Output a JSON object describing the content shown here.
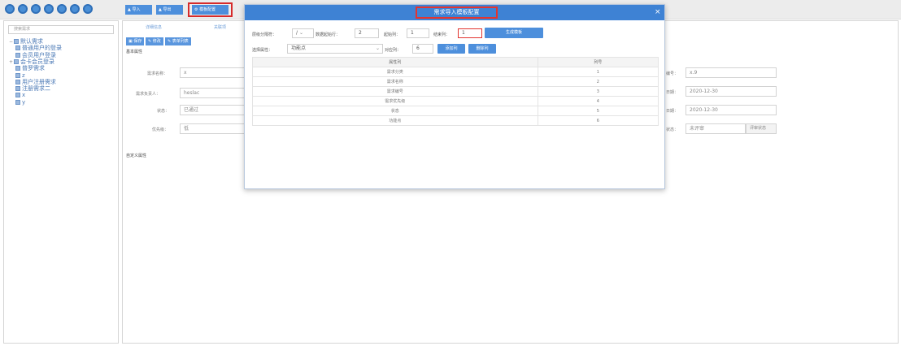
{
  "topbar": {
    "icon_buttons": [
      "circle-icon-1",
      "circle-icon-2",
      "circle-icon-3",
      "circle-icon-4",
      "circle-icon-5",
      "circle-icon-6",
      "circle-icon-7"
    ],
    "actions": [
      "导入",
      "导出",
      "模板配置"
    ]
  },
  "left": {
    "search_placeholder": "搜索需求",
    "tree": [
      {
        "label": "默认需求",
        "toggle": "−",
        "indent": 0
      },
      {
        "label": "普通用户的登录",
        "toggle": "",
        "indent": 1
      },
      {
        "label": "会员用户登录",
        "toggle": "",
        "indent": 1
      },
      {
        "label": "会卡会员登录",
        "toggle": "+",
        "indent": 0
      },
      {
        "label": "普罗需求",
        "toggle": "",
        "indent": 1
      },
      {
        "label": "z",
        "toggle": "",
        "indent": 1
      },
      {
        "label": "用户注册需求",
        "toggle": "",
        "indent": 1
      },
      {
        "label": "注册需求二",
        "toggle": "",
        "indent": 1
      },
      {
        "label": "x",
        "toggle": "",
        "indent": 1
      },
      {
        "label": "y",
        "toggle": "",
        "indent": 1
      }
    ]
  },
  "main": {
    "tabs": [
      "详细信息",
      "关联项"
    ],
    "buttons": [
      "保存",
      "修改",
      "表单列表"
    ],
    "section_basic": "基本属性",
    "section_custom": "自定义属性",
    "fields_left": [
      {
        "label": "需求名称：",
        "value": "x"
      },
      {
        "label": "需求负责人：",
        "value": "heslac"
      },
      {
        "label": "状态：",
        "value": "已通过"
      },
      {
        "label": "优先级：",
        "value": "低"
      }
    ],
    "fields_right": [
      {
        "label": "编号：",
        "value": "x.9"
      },
      {
        "label": "日期：",
        "value": "2020-12-30"
      },
      {
        "label": "日期：",
        "value": "2020-12-30"
      },
      {
        "label": "状态：",
        "value": "未评审",
        "extra": "评审状态"
      }
    ]
  },
  "modal": {
    "title": "需求导入模板配置",
    "close": "×",
    "sep_label": "层级分隔符：",
    "sep_value": "/",
    "start_label": "数据起始行：",
    "start_value": "2",
    "startcol_label": "起始列：",
    "startcol_value": "1",
    "endcol_label": "结束列：",
    "endcol_value": "1",
    "gen_button": "生成模板",
    "attr_label": "选择属性：",
    "attr_value": "功能点",
    "target_label": "对应列：",
    "target_value": "6",
    "add_button": "添加列",
    "del_button": "删除列",
    "table": {
      "headers": [
        "属性列",
        "列号"
      ],
      "rows": [
        [
          "需求分类",
          "1"
        ],
        [
          "需求名称",
          "2"
        ],
        [
          "需求编号",
          "3"
        ],
        [
          "需求优先级",
          "4"
        ],
        [
          "状态",
          "5"
        ],
        [
          "功能点",
          "6"
        ]
      ]
    }
  }
}
